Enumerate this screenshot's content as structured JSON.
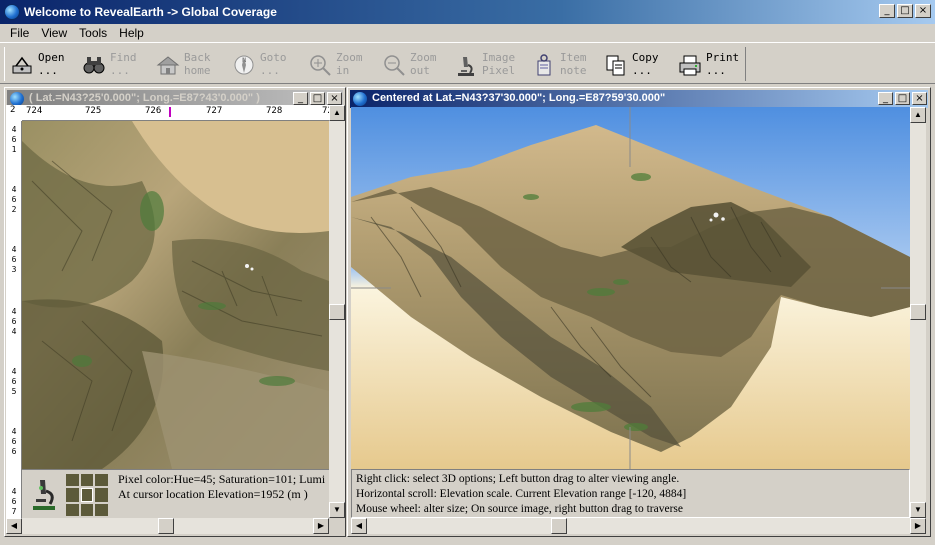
{
  "app": {
    "title": "Welcome to RevealEarth -> Global Coverage"
  },
  "window_buttons": [
    "_",
    "□",
    "×"
  ],
  "menu": [
    "File",
    "View",
    "Tools",
    "Help"
  ],
  "toolbar": [
    {
      "name": "open",
      "label": "Open\n...",
      "icon": "open-icon",
      "enabled": true
    },
    {
      "name": "find",
      "label": "Find\n...",
      "icon": "binoculars-icon",
      "enabled": false
    },
    {
      "name": "back",
      "label": "Back\nhome",
      "icon": "home-icon",
      "enabled": false
    },
    {
      "name": "goto",
      "label": "Goto\n...",
      "icon": "compass-icon",
      "enabled": false
    },
    {
      "name": "zoom-in",
      "label": "Zoom\nin",
      "icon": "zoom-in-icon",
      "enabled": false
    },
    {
      "name": "zoom-out",
      "label": "Zoom\nout",
      "icon": "zoom-out-icon",
      "enabled": false
    },
    {
      "name": "image-pixel",
      "label": "Image\nPixel",
      "icon": "microscope-icon",
      "enabled": false
    },
    {
      "name": "item-note",
      "label": "Item\nnote",
      "icon": "note-icon",
      "enabled": false
    },
    {
      "name": "copy",
      "label": "Copy\n...",
      "icon": "copy-icon",
      "enabled": true
    },
    {
      "name": "print",
      "label": "Print\n...",
      "icon": "printer-icon",
      "enabled": true
    }
  ],
  "left_window": {
    "title": "( Lat.=N43?25'0.000\"; Long.=E87?43'0.000\" )",
    "ruler_corner": "2",
    "ruler_top": [
      "724",
      "725",
      "726",
      "727",
      "728",
      "72"
    ],
    "ruler_left": [
      "4\n6\n1",
      "4\n6\n2",
      "4\n6\n3",
      "4\n6\n4",
      "4\n6\n5",
      "4\n6\n6",
      "4\n6\n7"
    ],
    "info_line1": "Pixel color:Hue=45;  Saturation=101;  Lumi",
    "info_line2": "At cursor location Elevation=1952 (m )"
  },
  "right_window": {
    "title": "Centered at Lat.=N43?37'30.000\"; Long.=E87?59'30.000\"",
    "status_lines": [
      "Right click: select 3D options; Left button drag to alter viewing angle.",
      "Horizontal scroll: Elevation scale. Current Elevation range [-120, 4884]",
      "Mouse wheel: alter size; On source image, right button drag to traverse"
    ]
  },
  "colors": {
    "titlebar_active": "#0a246a",
    "titlebar_inactive": "#808080",
    "face": "#d4d0c8",
    "sky": "#6fa8e8",
    "ground_sand": "#d8b888"
  }
}
